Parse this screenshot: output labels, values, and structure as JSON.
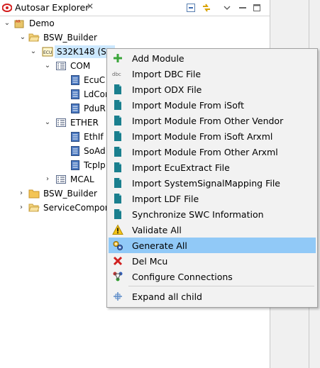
{
  "tab": {
    "title": "Autosar Explorer",
    "close": "✕"
  },
  "tree": {
    "demo": "Demo",
    "bsw_builder": "BSW_Builder",
    "s32k148": "S32K148 (S3",
    "com": "COM",
    "ecuc": "EcuC",
    "ldcom": "LdCor",
    "pdur": "PduR",
    "ether": "ETHER",
    "ethif": "EthIf",
    "soad": "SoAd",
    "tcpip": "TcpIp",
    "mcal": "MCAL",
    "bsw_builder2": "BSW_Builder",
    "service_component": "ServiceCompor"
  },
  "menu": {
    "items": [
      {
        "label": "Add Module",
        "icon": "add-icon"
      },
      {
        "label": "Import DBC File",
        "icon": "dbc-icon"
      },
      {
        "label": "Import ODX File",
        "icon": "file-icon"
      },
      {
        "label": "Import Module From iSoft",
        "icon": "file-icon"
      },
      {
        "label": "Import Module From Other Vendor",
        "icon": "file-icon"
      },
      {
        "label": "Import Module From iSoft Arxml",
        "icon": "file-icon"
      },
      {
        "label": "Import Module From Other Arxml",
        "icon": "file-icon"
      },
      {
        "label": "Import EcuExtract File",
        "icon": "file-icon"
      },
      {
        "label": "Import SystemSignalMapping File",
        "icon": "file-icon"
      },
      {
        "label": "Import LDF File",
        "icon": "file-icon"
      },
      {
        "label": "Synchronize SWC Information",
        "icon": "file-icon"
      },
      {
        "label": "Validate All",
        "icon": "warning-icon"
      },
      {
        "label": "Generate All",
        "icon": "gears-icon"
      },
      {
        "label": "Del Mcu",
        "icon": "delete-icon"
      },
      {
        "label": "Configure Connections",
        "icon": "connections-icon"
      },
      {
        "label": "Expand all child",
        "icon": "expand-icon"
      }
    ]
  },
  "colors": {
    "selection": "#cce8ff",
    "menu_hover": "#91c9f7",
    "menu_bg": "#f2f2f2",
    "file_teal": "#1a7f8e"
  }
}
